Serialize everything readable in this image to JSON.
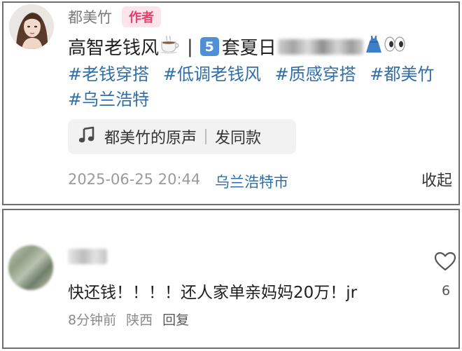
{
  "post": {
    "author_name": "都美竹",
    "author_badge": "作者",
    "title_text": "高智老钱风",
    "title_separator": "|",
    "title_number": "5",
    "title_text2": "套夏日",
    "tags": [
      "#老钱穿搭",
      "#低调老钱风",
      "#质感穿搭",
      "#都美竹",
      "#乌兰浩特"
    ],
    "sound_label": "都美竹的原声",
    "sound_action": "发同款",
    "date": "2025-06-25 20:44",
    "location": "乌兰浩特市",
    "collapse_label": "收起",
    "icons": {
      "title_decoration_1": "coffee-cup-icon",
      "title_decoration_2": "dress-icon",
      "title_decoration_3": "eyes-icon",
      "sound": "music-note-icon"
    }
  },
  "comment": {
    "text": "快还钱！！！！还人家单亲妈妈20万！jr",
    "time": "8分钟前",
    "region": "陕西",
    "reply_label": "回复",
    "like_count": "6",
    "like_icon": "heart-icon"
  },
  "colors": {
    "link_blue": "#2f6ea8",
    "badge_pink_text": "#e2446c",
    "badge_pink_bg": "#fbe4ea",
    "card_border": "#6e6e6e"
  }
}
